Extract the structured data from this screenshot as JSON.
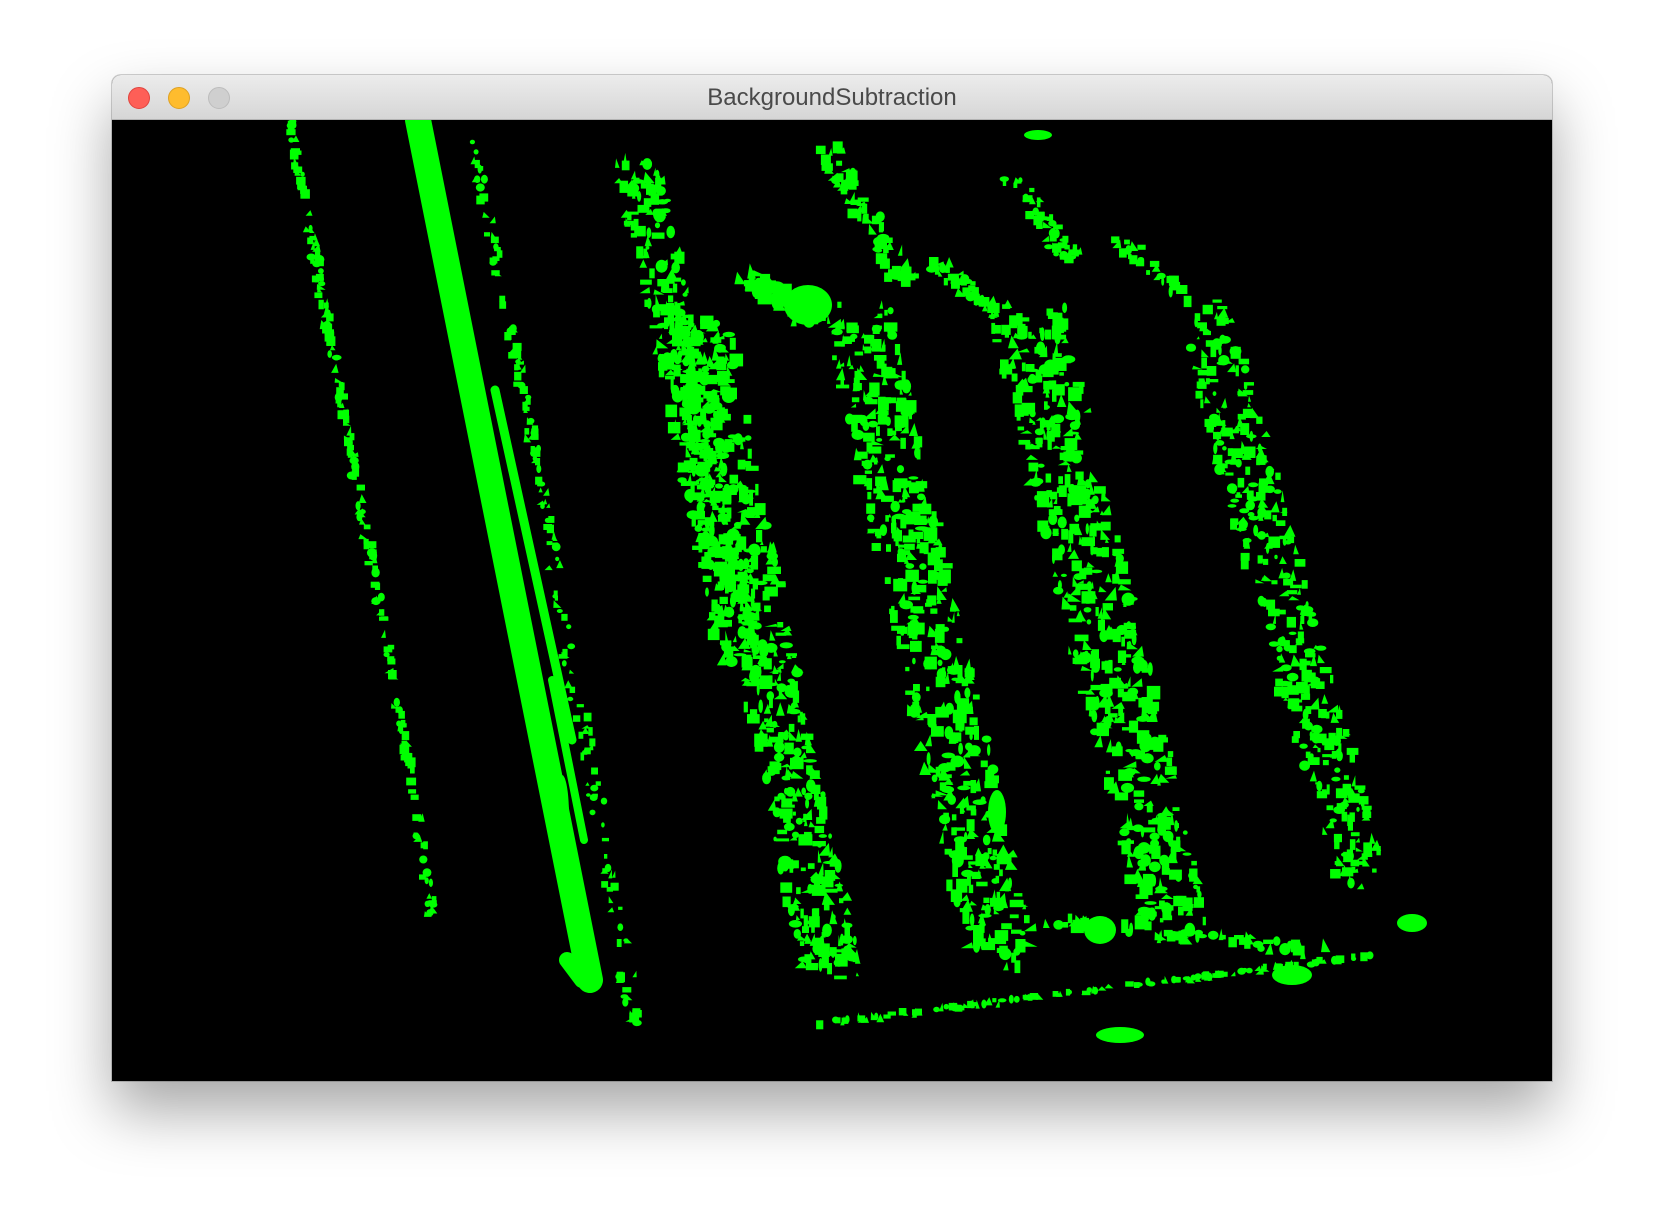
{
  "window": {
    "title": "BackgroundSubtraction"
  },
  "controls": {
    "close": "close-button",
    "minimize": "minimize-button",
    "zoom": "zoom-button"
  },
  "frame": {
    "background_color": "#000000",
    "mask_color": "#00ff00"
  }
}
